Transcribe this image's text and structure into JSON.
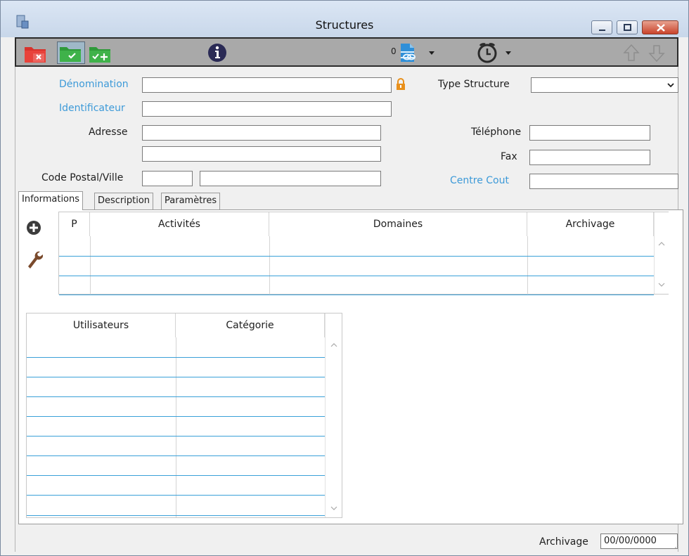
{
  "window": {
    "title": "Structures"
  },
  "toolbar": {
    "doc_counter": "0"
  },
  "form": {
    "denomination_label": "Dénomination",
    "denomination_value": "",
    "identificateur_label": "Identificateur",
    "identificateur_value": "",
    "adresse_label": "Adresse",
    "adresse_line1": "",
    "adresse_line2": "",
    "code_postal_ville_label": "Code Postal/Ville",
    "code_postal_value": "",
    "ville_value": "",
    "type_structure_label": "Type Structure",
    "type_structure_value": "",
    "telephone_label": "Téléphone",
    "telephone_value": "",
    "fax_label": "Fax",
    "fax_value": "",
    "centre_cout_label": "Centre Cout",
    "centre_cout_value": ""
  },
  "tabs": [
    {
      "label": "Informations"
    },
    {
      "label": "Description"
    },
    {
      "label": "Paramètres"
    }
  ],
  "activities_table": {
    "columns": [
      "P",
      "Activités",
      "Domaines",
      "Archivage"
    ],
    "rows": [
      [
        "",
        "",
        "",
        ""
      ],
      [
        "",
        "",
        "",
        ""
      ],
      [
        "",
        "",
        "",
        ""
      ]
    ]
  },
  "users_table": {
    "columns": [
      "Utilisateurs",
      "Catégorie"
    ],
    "rows": [
      [
        "",
        ""
      ],
      [
        "",
        ""
      ],
      [
        "",
        ""
      ],
      [
        "",
        ""
      ],
      [
        "",
        ""
      ],
      [
        "",
        ""
      ],
      [
        "",
        ""
      ],
      [
        "",
        ""
      ],
      [
        "",
        ""
      ]
    ]
  },
  "footer": {
    "archivage_label": "Archivage",
    "archivage_value": "00/00/0000"
  },
  "colors": {
    "required_label": "#3d9ad8",
    "grid_row_line": "#3aa0d8",
    "lock_icon": "#e8901c"
  }
}
